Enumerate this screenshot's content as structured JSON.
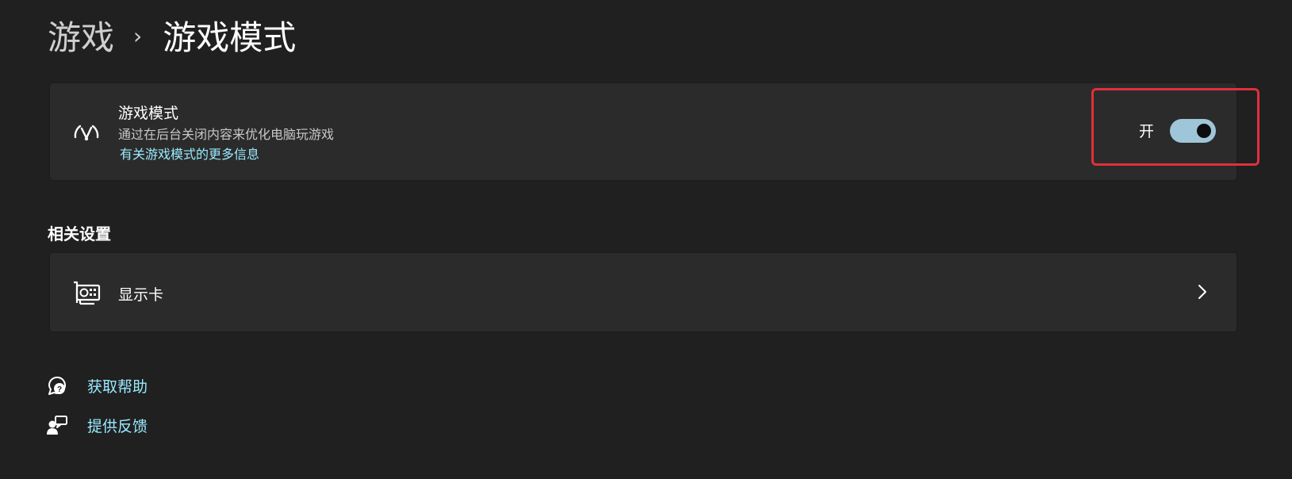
{
  "breadcrumb": {
    "parent": "游戏",
    "separator": "›",
    "current": "游戏模式"
  },
  "game_mode": {
    "icon": "speedometer-icon",
    "title": "游戏模式",
    "description": "通过在后台关闭内容来优化电脑玩游戏",
    "link": "有关游戏模式的更多信息",
    "toggle_label": "开",
    "toggle_on": true,
    "toggle_color": "#9fc5d8"
  },
  "related": {
    "heading": "相关设置",
    "items": [
      {
        "icon": "graphics-card-icon",
        "label": "显示卡",
        "chevron": "chevron-right-icon"
      }
    ]
  },
  "footer": {
    "help": {
      "icon": "help-chat-icon",
      "label": "获取帮助"
    },
    "feedback": {
      "icon": "feedback-icon",
      "label": "提供反馈"
    }
  },
  "colors": {
    "background": "#202020",
    "card": "#2b2b2b",
    "link": "#99ebff",
    "highlight": "#e0303c"
  }
}
